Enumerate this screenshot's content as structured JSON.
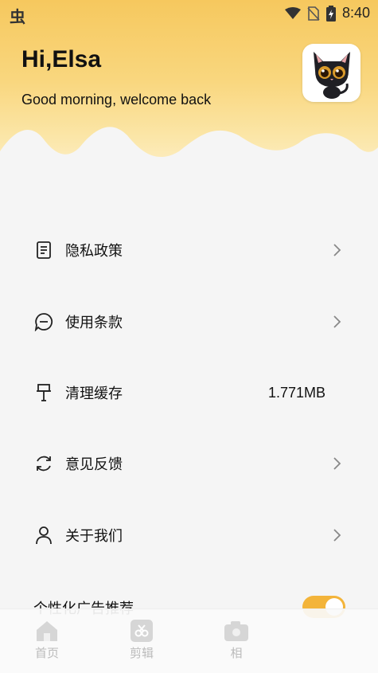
{
  "status_bar": {
    "time": "8:40",
    "app_icon": "bug-app-icon"
  },
  "header": {
    "title": "Hi,Elsa",
    "subtitle": "Good morning, welcome back",
    "avatar_icon": "black-cat-avatar",
    "gradient_colors": [
      "#f6c85e",
      "#fdf1d0"
    ]
  },
  "menu": {
    "items": [
      {
        "label": "隐私政策",
        "icon": "document-icon"
      },
      {
        "label": "使用条款",
        "icon": "chat-bubble-icon"
      },
      {
        "label": "清理缓存",
        "icon": "broom-icon",
        "value": "1.771MB"
      },
      {
        "label": "意见反馈",
        "icon": "refresh-icon"
      },
      {
        "label": "关于我们",
        "icon": "user-icon"
      }
    ]
  },
  "ad_toggle": {
    "label": "个性化广告推荐",
    "on": true,
    "color": "#f3b43a"
  },
  "bottom_nav": {
    "items": [
      {
        "label": "首页",
        "icon": "home-icon"
      },
      {
        "label": "剪辑",
        "icon": "film-cut-icon"
      },
      {
        "label": "相",
        "icon": "camera-icon"
      }
    ]
  }
}
